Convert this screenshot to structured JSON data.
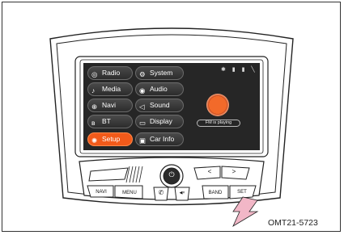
{
  "menu_left": [
    {
      "label": "Radio",
      "icon": "radio-icon",
      "active": false
    },
    {
      "label": "Media",
      "icon": "media-icon",
      "active": false
    },
    {
      "label": "Navi",
      "icon": "navi-icon",
      "active": false
    },
    {
      "label": "BT",
      "icon": "bluetooth-icon",
      "active": false
    },
    {
      "label": "Setup",
      "icon": "setup-icon",
      "active": true
    }
  ],
  "menu_right": [
    {
      "label": "System",
      "icon": "system-icon"
    },
    {
      "label": "Audio",
      "icon": "audio-icon"
    },
    {
      "label": "Sound",
      "icon": "sound-icon"
    },
    {
      "label": "Display",
      "icon": "display-icon"
    },
    {
      "label": "Car Info",
      "icon": "car-info-icon"
    }
  ],
  "status_icons": "✱ ▮ ▮ ╲",
  "now_playing": "FM is playing",
  "buttons": {
    "navi": "NAVI",
    "menu": "MENU",
    "band": "BAND",
    "set": "SET",
    "power": "⏻",
    "phone": "✆",
    "mute": "◀×",
    "left": "<",
    "right": ">"
  },
  "caption": "OMT21-5723",
  "colors": {
    "active": "#f25a1a",
    "arrow": "#f2b7c7",
    "screen_bg": "#262626"
  }
}
